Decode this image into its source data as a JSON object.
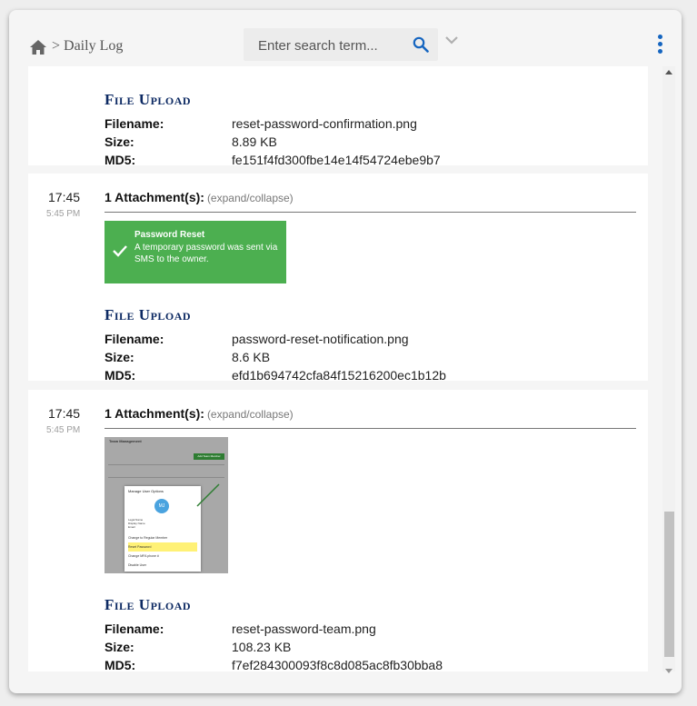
{
  "header": {
    "breadcrumb": "> Daily Log",
    "search_placeholder": "Enter search term..."
  },
  "entries": [
    {
      "file_upload": {
        "title": "File Upload",
        "filename_label": "Filename:",
        "filename": "reset-password-confirmation.png",
        "size_label": "Size:",
        "size": "8.89 KB",
        "md5_label": "MD5:",
        "md5": "fe151f4fd300fbe14e14f54724ebe9b7"
      }
    },
    {
      "time": "17:45",
      "time_small": "5:45 PM",
      "attachments_label": "1 Attachment(s):",
      "expand_label": "(expand/collapse)",
      "toast": {
        "title": "Password Reset",
        "message": "A temporary password was sent via SMS to the owner."
      },
      "file_upload": {
        "title": "File Upload",
        "filename_label": "Filename:",
        "filename": "password-reset-notification.png",
        "size_label": "Size:",
        "size": "8.6 KB",
        "md5_label": "MD5:",
        "md5": "efd1b694742cfa84f15216200ec1b12b"
      }
    },
    {
      "time": "17:45",
      "time_small": "5:45 PM",
      "attachments_label": "1 Attachment(s):",
      "expand_label": "(expand/collapse)",
      "thumbnail": {
        "header": "Team Management",
        "button": "Add Team Member",
        "dialog_title": "Manage User Options",
        "avatar": "MJ",
        "legal_name": "Legal Name",
        "display_name": "Display Name",
        "email": "Email",
        "options": [
          "Change to Regular Member",
          "Reset Password",
          "Change MFA phone #",
          "Disable User"
        ]
      },
      "file_upload": {
        "title": "File Upload",
        "filename_label": "Filename:",
        "filename": "reset-password-team.png",
        "size_label": "Size:",
        "size": "108.23 KB",
        "md5_label": "MD5:",
        "md5": "f7ef284300093f8c8d085ac8fb30bba8"
      }
    }
  ],
  "colors": {
    "accent": "#1565c0",
    "title_navy": "#0d2a63",
    "toast_green": "#4caf50"
  }
}
